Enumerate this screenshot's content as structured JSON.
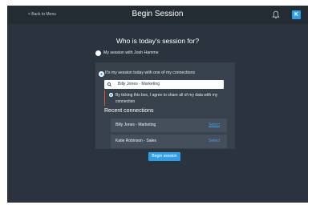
{
  "header": {
    "back_label": "<  Back to Menu",
    "title": "Begin Session",
    "icons": [
      "bell-icon"
    ],
    "avatar_initial": "K",
    "avatar_color": "#2f9ee8"
  },
  "main": {
    "question": "Who is today's session for?",
    "option_self": {
      "label": "My session with Josh Hamme",
      "selected": false
    },
    "option_connection": {
      "label": "It's my session today with one of my connections",
      "selected": true,
      "search": {
        "value": "Billy Jones - Marketing",
        "placeholder": "",
        "icon": "search-icon"
      },
      "consent": {
        "checked": true,
        "text": "By ticking this box, I agree to share all of my data with my connection"
      },
      "recent_heading": "Recent connections",
      "connections": [
        {
          "name": "Billy Jones - Marketing",
          "action": "Select"
        },
        {
          "name": "Katie Robinson - Sales",
          "action": "Select"
        }
      ]
    },
    "begin_label": "Begin session"
  },
  "colors": {
    "background": "#2b343e",
    "topbar": "#232b33",
    "panel": "#38424d",
    "accent": "#2f9ee8",
    "consent_bar": "#e0533a"
  }
}
